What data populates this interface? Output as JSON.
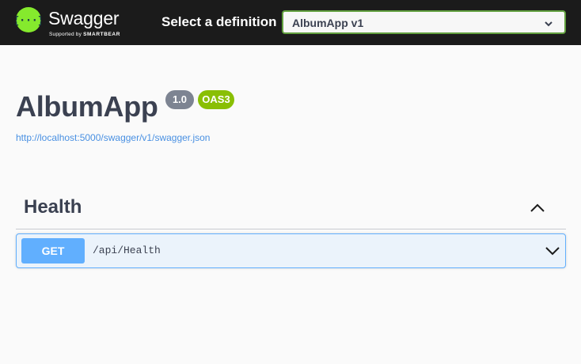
{
  "topbar": {
    "brand_name": "Swagger",
    "brand_sub_prefix": "Supported by",
    "brand_sub_company": "SMARTBEAR",
    "brand_color": "#85ea2d",
    "definition_label": "Select a definition",
    "definition_selected": "AlbumApp v1",
    "definition_icon": "chevron-down-icon"
  },
  "info": {
    "title": "AlbumApp",
    "version_badge": "1.0",
    "oas_badge": "OAS3",
    "spec_url": "http://localhost:5000/swagger/v1/swagger.json"
  },
  "tags": [
    {
      "name": "Health",
      "expanded": true,
      "toggle_icon": "chevron-up-icon",
      "operations": [
        {
          "method": "GET",
          "method_color": "#61affe",
          "path": "/api/Health",
          "toggle_icon": "chevron-down-icon"
        }
      ]
    }
  ]
}
